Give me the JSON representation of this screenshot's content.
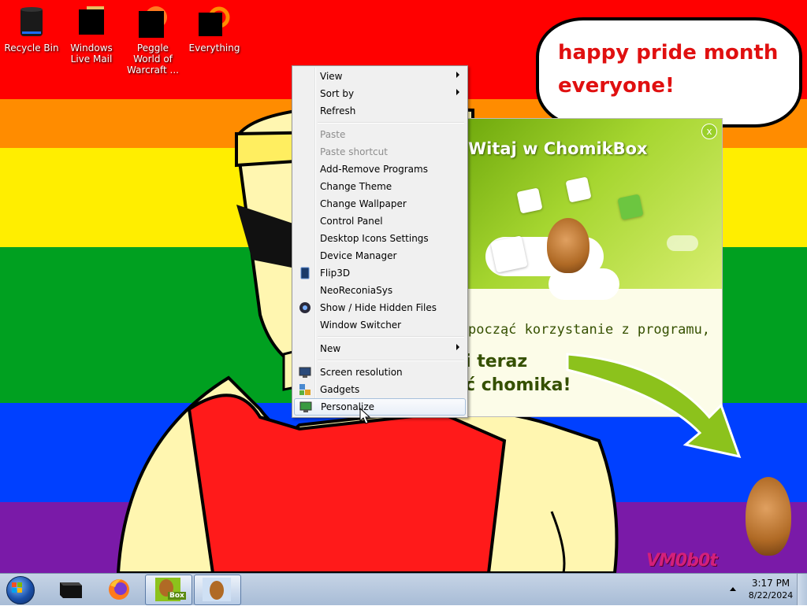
{
  "desktop": {
    "icons": [
      {
        "label": "Recycle Bin",
        "icon": "recycle-bin-icon"
      },
      {
        "label": "Windows Live Mail",
        "icon": "windows-live-mail-icon"
      },
      {
        "label": "Peggle World of Warcraft ...",
        "icon": "peggle-icon"
      },
      {
        "label": "Everything",
        "icon": "everything-search-icon"
      }
    ],
    "bubble_text": "happy pride month everyone!",
    "watermark": "VM0b0t",
    "stripe_colors": [
      "#ff0000",
      "#ff8c00",
      "#ffee00",
      "#00a020",
      "#0040ff",
      "#7a1aa8"
    ]
  },
  "chomikbox": {
    "title": "Witaj w ChomikBox",
    "close": "x",
    "line1": "począć korzystanie z programu,",
    "line2": "i teraz",
    "line3": "ć chomika!",
    "accent": "#8cc21c"
  },
  "context_menu": {
    "items": [
      {
        "label": "View",
        "submenu": true
      },
      {
        "label": "Sort by",
        "submenu": true
      },
      {
        "label": "Refresh"
      },
      {
        "label": "Paste",
        "disabled": true
      },
      {
        "label": "Paste shortcut",
        "disabled": true
      },
      {
        "label": "Add-Remove Programs"
      },
      {
        "label": "Change Theme"
      },
      {
        "label": "Change Wallpaper"
      },
      {
        "label": "Control Panel"
      },
      {
        "label": "Desktop Icons Settings"
      },
      {
        "label": "Device Manager"
      },
      {
        "label": "Flip3D",
        "icon": "flip3d-icon"
      },
      {
        "label": "NeoReconiaSys"
      },
      {
        "label": "Show / Hide Hidden Files",
        "icon": "hidden-files-icon"
      },
      {
        "label": "Window Switcher"
      },
      {
        "label": "New",
        "submenu": true
      },
      {
        "label": "Screen resolution",
        "icon": "screen-resolution-icon"
      },
      {
        "label": "Gadgets",
        "icon": "gadgets-icon"
      },
      {
        "label": "Personalize",
        "icon": "personalize-icon",
        "highlighted": true
      }
    ]
  },
  "taskbar": {
    "buttons": [
      {
        "name": "start-button",
        "icon": "windows-logo-icon"
      },
      {
        "name": "taskbar-recycle-app",
        "icon": "black-box-icon"
      },
      {
        "name": "taskbar-firefox",
        "icon": "firefox-icon"
      },
      {
        "name": "taskbar-chomikbox",
        "icon": "chomikbox-icon",
        "badge": "Box"
      },
      {
        "name": "taskbar-hamster",
        "icon": "hamster-icon"
      }
    ],
    "clock_time": "3:17 PM",
    "clock_date": "8/22/2024",
    "color": "#b4c6dc"
  }
}
